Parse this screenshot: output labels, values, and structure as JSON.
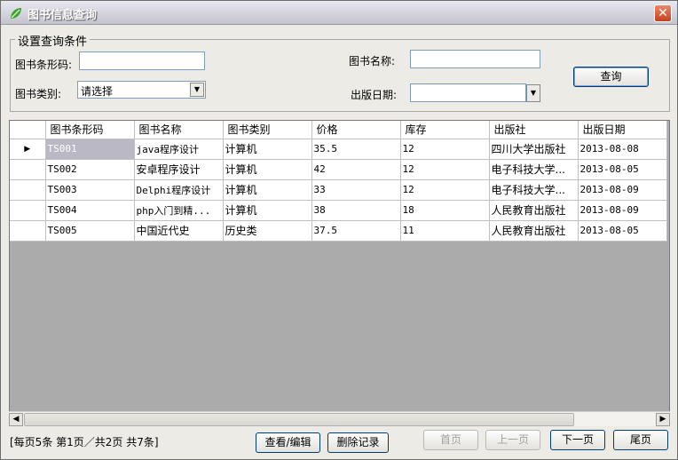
{
  "window": {
    "title": "图书信息查询"
  },
  "query": {
    "group_title": "设置查询条件",
    "barcode_label": "图书条形码:",
    "barcode_value": "",
    "name_label": "图书名称:",
    "name_value": "",
    "category_label": "图书类别:",
    "category_value": "请选择",
    "date_label": "出版日期:",
    "date_value": "",
    "search_button": "查询"
  },
  "table": {
    "columns": [
      "图书条形码",
      "图书名称",
      "图书类别",
      "价格",
      "库存",
      "出版社",
      "出版日期"
    ],
    "rows": [
      [
        "TS001",
        "java程序设计",
        "计算机",
        "35.5",
        "12",
        "四川大学出版社",
        "2013-08-08"
      ],
      [
        "TS002",
        "安卓程序设计",
        "计算机",
        "42",
        "12",
        "电子科技大学...",
        "2013-08-05"
      ],
      [
        "TS003",
        "Delphi程序设计",
        "计算机",
        "33",
        "12",
        "电子科技大学...",
        "2013-08-09"
      ],
      [
        "TS004",
        "php入门到精...",
        "计算机",
        "38",
        "18",
        "人民教育出版社",
        "2013-08-09"
      ],
      [
        "TS005",
        "中国近代史",
        "历史类",
        "37.5",
        "11",
        "人民教育出版社",
        "2013-08-05"
      ]
    ]
  },
  "footer": {
    "status": "[每页5条 第1页／共2页    共7条]",
    "view_edit_button": "查看/编辑",
    "delete_button": "删除记录",
    "first_button": "首页",
    "prev_button": "上一页",
    "next_button": "下一页",
    "last_button": "尾页"
  }
}
